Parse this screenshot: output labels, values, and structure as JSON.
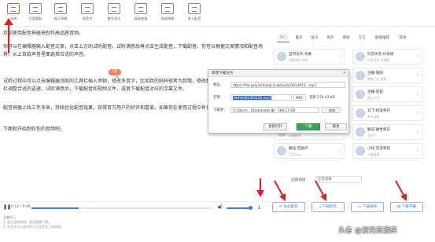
{
  "toolbar": {
    "items": [
      {
        "label": "试听",
        "icon": "play-icon"
      },
      {
        "label": "文案提取",
        "icon": "document-icon"
      },
      {
        "label": "插入停顿",
        "icon": "pause-icon"
      },
      {
        "label": "多音字",
        "icon": "pinyin-icon"
      },
      {
        "label": "数字读法",
        "icon": "number-icon"
      },
      {
        "label": "局部变速",
        "icon": "speed-icon"
      },
      {
        "label": "局部停顿",
        "icon": "stop-icon"
      },
      {
        "label": "多人配音",
        "icon": "users-icon"
      }
    ]
  },
  "editor": {
    "paragraphs": [
      "欢迎使用配音神器来制作高品质音频。",
      "你可以在编辑器输入配音文案，点击上方的试听配音，试听满意后再点击生成配音，下载配音。你可以根据文案情况和配音场景，从上百款声音里面选择合适的声音。",
      "试听过程中可以点击编辑器顶部的工具栏插入停顿，修改多音字，比如我的妈妈很疼为我哦，修改数字读法等，你也可以在语速栏调整合适的语速，试听满意后，下载配音和视频文件，或者下载配音对应的字幕文件。",
      "配音神器上线三年多来，持续优化配音效果，获得百万用户的好评和喜爱。如果你在使用过程中有任何问题，欢迎联系我们。",
      "下面就开始制作你的音频吧。"
    ],
    "pause_badge": "1秒"
  },
  "player": {
    "time": "0:12 / 0:46",
    "progress": 0.26,
    "volume": 0.85
  },
  "notes": [
    "温馨提示:",
    "1. 超过字数限制，配音需要付费。",
    "2. 多音字可以选中并点击多音字工具修改。"
  ],
  "voice_panel": {
    "tabs": [
      "热门",
      "童声",
      "女声",
      "男声",
      "情感",
      "方言",
      "超级推荐",
      "其他"
    ],
    "active_tab": 0,
    "voices": [
      {
        "name": "自然女声·文惠",
        "sub": "温柔亲和 宣传"
      },
      {
        "name": "抖音声音·抖女娇",
        "sub": "时尚活泼 短视频"
      },
      {
        "name": "解说·磁性男声",
        "sub": "影视解说 纪录"
      },
      {
        "name": "主播·阳阳",
        "sub": "营销广告 直播"
      },
      {
        "name": "情感女声·小婉",
        "sub": "情感电台"
      },
      {
        "name": "主播·苗苗",
        "sub": "商品介绍"
      },
      {
        "name": "新闻·沉稳男声",
        "sub": "新闻播报"
      },
      {
        "name": "云飞·标准男声",
        "sub": "有声读物"
      },
      {
        "name": "动漫·萌系少女",
        "sub": "动漫配音"
      },
      {
        "name": "解说·磁性男声",
        "sub": "宣传片"
      },
      {
        "name": "精品·百姓声",
        "sub": "生活vlog"
      },
      {
        "name": "小咔·活泼男孩",
        "sub": "儿童故事"
      }
    ],
    "speed_label": "选择语速",
    "speed_value": "正常语速"
  },
  "actions": [
    {
      "label": "生成配音",
      "icon": "refresh-icon"
    },
    {
      "label": "下载配音",
      "icon": "download-icon"
    },
    {
      "label": "下载视频",
      "icon": "video-icon"
    },
    {
      "label": "下载字幕",
      "icon": "subtitle-icon"
    }
  ],
  "dialog": {
    "title": "新建下载任务",
    "url_label": "网址：",
    "url_value": "https://file.peiyinshenqi.club/audio/2023051...mp3",
    "name_label": "名称：",
    "name_value": "PeiPei202305150.mp3",
    "name_ext": "MP3",
    "size_text": "音频 274.43 KB",
    "path_label": "下载到：",
    "path_value": "C:\\Users\\...\\Downloads  剩：168.11 GB",
    "browse": "浏览",
    "btn_open": "直接打开",
    "btn_download": "下载",
    "btn_cancel": "取消"
  },
  "watermark": "头条 @爱找资源库",
  "colors": {
    "accent": "#3b7cf6",
    "arrow": "#e02020",
    "download_green": "#34a853"
  }
}
